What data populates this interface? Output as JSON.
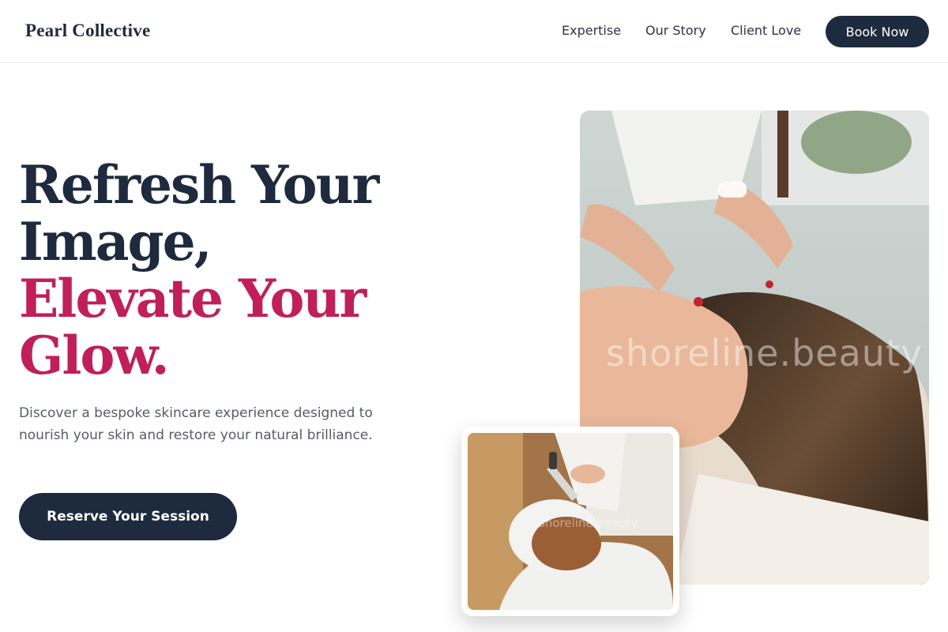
{
  "brand": {
    "name": "Pearl Collective"
  },
  "nav": {
    "items": [
      {
        "label": "Expertise"
      },
      {
        "label": "Our Story"
      },
      {
        "label": "Client Love"
      }
    ],
    "cta_label": "Book Now"
  },
  "hero": {
    "headline_line1": "Refresh Your",
    "headline_line2": "Image,",
    "headline_line3": "Elevate Your",
    "headline_line4": "Glow.",
    "description": "Discover a bespoke skincare experience designed to nourish your skin and restore your natural brilliance.",
    "cta_label": "Reserve Your Session"
  },
  "images": {
    "main_alt": "Esthetician performing a facial treatment",
    "main_watermark": "shoreline.beauty",
    "thumb_alt": "Client receiving a clay mask application",
    "thumb_watermark": "shoreline.beauty"
  },
  "colors": {
    "navy": "#1e2a3d",
    "accent_pink": "#c01f5a",
    "body_text": "#555c66"
  }
}
